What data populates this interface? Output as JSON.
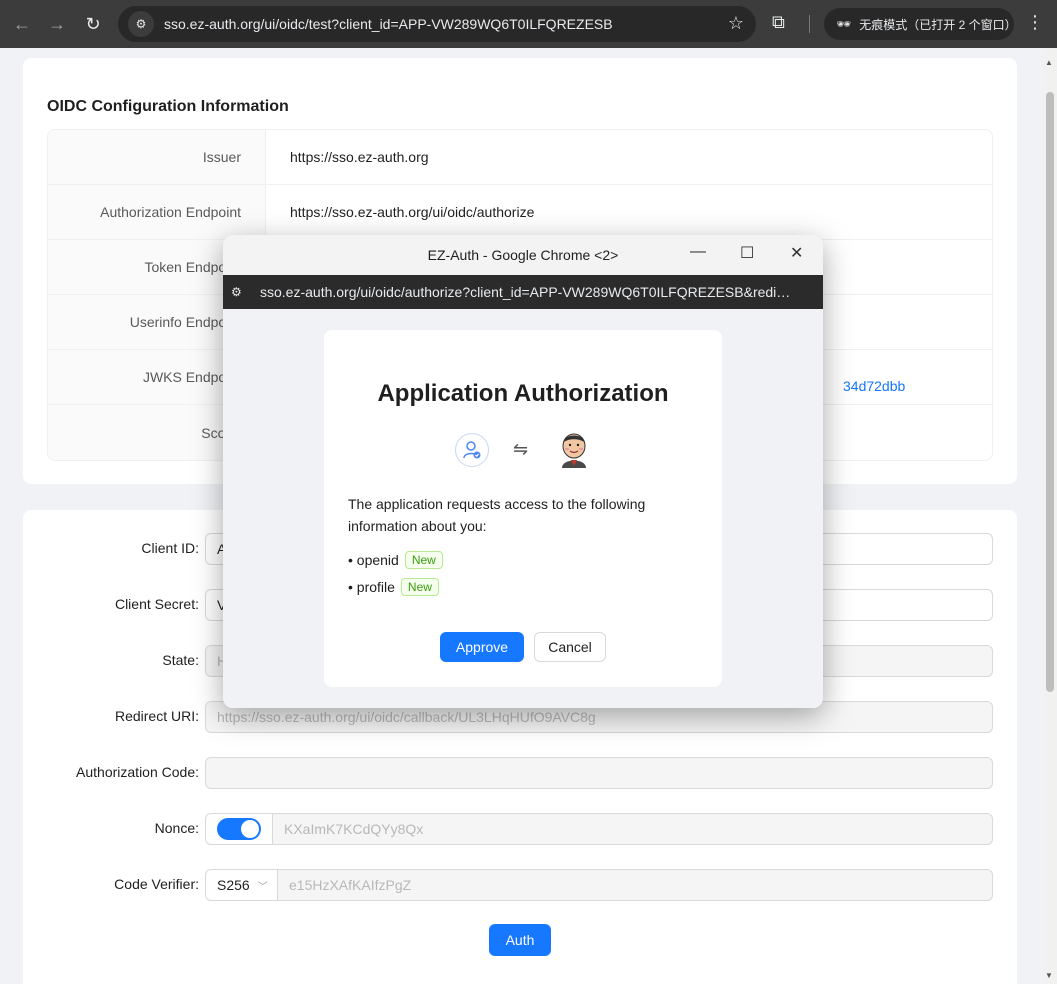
{
  "browser": {
    "url": "sso.ez-auth.org/ui/oidc/test?client_id=APP-VW289WQ6T0ILFQREZESB",
    "incognito_label": "无痕模式（已打开 2 个窗口）"
  },
  "config_card": {
    "title": "OIDC Configuration Information",
    "rows": [
      {
        "label": "Issuer",
        "value": "https://sso.ez-auth.org"
      },
      {
        "label": "Authorization Endpoint",
        "value": "https://sso.ez-auth.org/ui/oidc/authorize"
      },
      {
        "label": "Token Endpoint",
        "value": ""
      },
      {
        "label": "Userinfo Endpoint",
        "value": ""
      },
      {
        "label": "JWKS Endpoint",
        "value": ""
      },
      {
        "label": "Scope",
        "value": ""
      }
    ],
    "jwks_fragment": "34d72dbb"
  },
  "form": {
    "client_id": {
      "label": "Client ID",
      "value": "A"
    },
    "client_secret": {
      "label": "Client Secret",
      "value": "V"
    },
    "state": {
      "label": "State",
      "value": "H"
    },
    "redirect_uri": {
      "label": "Redirect URI",
      "value": "https://sso.ez-auth.org/ui/oidc/callback/UL3LHqHUfO9AVC8g"
    },
    "authorization_code": {
      "label": "Authorization Code",
      "value": ""
    },
    "nonce": {
      "label": "Nonce",
      "value": "KXaImK7KCdQYy8Qx",
      "enabled": true
    },
    "code_verifier": {
      "label": "Code Verifier",
      "method": "S256",
      "value": "e15HzXAfKAIfzPgZ"
    },
    "auth_button": "Auth"
  },
  "popup": {
    "window_title": "EZ-Auth - Google Chrome <2>",
    "url": "sso.ez-auth.org/ui/oidc/authorize?client_id=APP-VW289WQ6T0ILFQREZESB&redi…",
    "title": "Application Authorization",
    "message": "The application requests access to the following information about you:",
    "scopes": [
      {
        "name": "• openid",
        "tag": "New"
      },
      {
        "name": "• profile",
        "tag": "New"
      }
    ],
    "approve": "Approve",
    "cancel": "Cancel"
  },
  "colors": {
    "primary": "#1677ff",
    "tag_green": "#389e0d"
  }
}
